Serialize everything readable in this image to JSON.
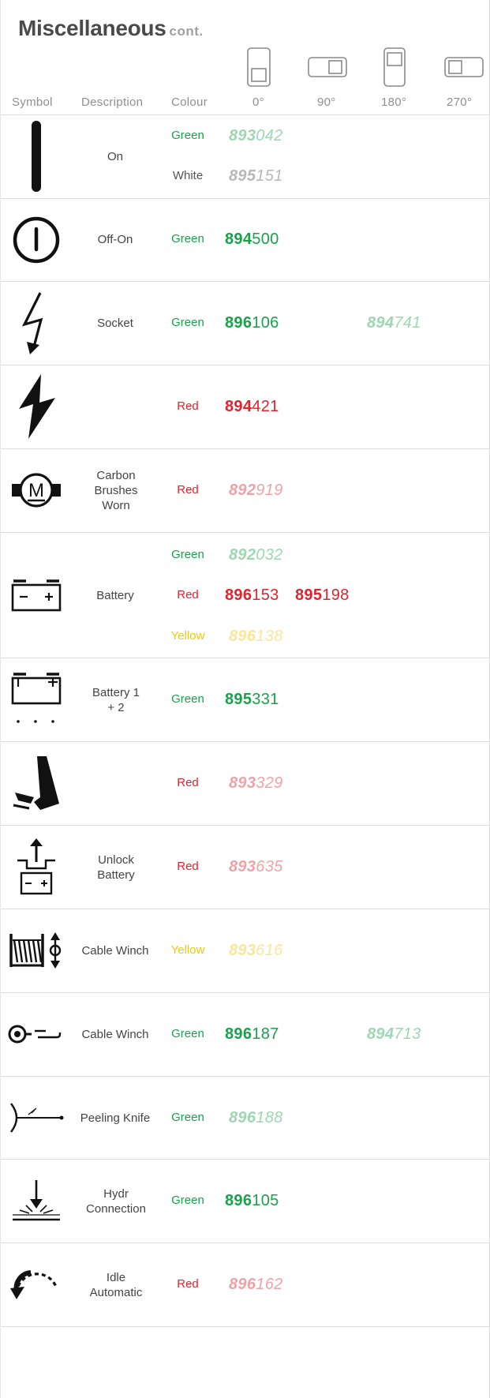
{
  "page": {
    "title": "Miscellaneous",
    "title_suffix": "cont."
  },
  "headers": {
    "symbol": "Symbol",
    "description": "Description",
    "colour": "Colour",
    "deg0": "0°",
    "deg90": "90°",
    "deg180": "180°",
    "deg270": "270°"
  },
  "rows": [
    {
      "symbol": "on-icon",
      "description": "On",
      "entries": [
        {
          "colour": "Green",
          "code_prefix": "893",
          "code_suffix": "042",
          "orientation": "0°",
          "dim": true
        },
        {
          "colour": "White",
          "code_prefix": "895",
          "code_suffix": "151",
          "orientation": "0°",
          "dim": true
        }
      ]
    },
    {
      "symbol": "off-on-icon",
      "description": "Off-On",
      "entries": [
        {
          "colour": "Green",
          "code_prefix": "894",
          "code_suffix": "500",
          "orientation": "0°",
          "dim": false
        }
      ]
    },
    {
      "symbol": "socket-icon",
      "description": "Socket",
      "entries": [
        {
          "colour": "Green",
          "code_prefix": "896",
          "code_suffix": "106",
          "orientation": "0°",
          "dim": false,
          "code2_prefix": "894",
          "code2_suffix": "741",
          "code2_orientation": "180°",
          "code2_dim": true
        }
      ]
    },
    {
      "symbol": "lightning-icon",
      "description": "",
      "entries": [
        {
          "colour": "Red",
          "code_prefix": "894",
          "code_suffix": "421",
          "orientation": "0°",
          "dim": false
        }
      ]
    },
    {
      "symbol": "motor-icon",
      "description": "Carbon Brushes Worn",
      "entries": [
        {
          "colour": "Red",
          "code_prefix": "892",
          "code_suffix": "919",
          "orientation": "0°",
          "dim": true
        }
      ]
    },
    {
      "symbol": "battery-icon",
      "description": "Battery",
      "entries": [
        {
          "colour": "Green",
          "code_prefix": "892",
          "code_suffix": "032",
          "orientation": "0°",
          "dim": true
        },
        {
          "colour": "Red",
          "code_prefix": "896",
          "code_suffix": "153",
          "orientation": "0°",
          "dim": false,
          "code2_prefix": "895",
          "code2_suffix": "198",
          "code2_orientation": "90°",
          "code2_dim": false
        },
        {
          "colour": "Yellow",
          "code_prefix": "896",
          "code_suffix": "138",
          "orientation": "0°",
          "dim": true
        }
      ]
    },
    {
      "symbol": "battery-1-2-icon",
      "description": "Battery 1 + 2",
      "entries": [
        {
          "colour": "Green",
          "code_prefix": "895",
          "code_suffix": "331",
          "orientation": "0°",
          "dim": false
        }
      ]
    },
    {
      "symbol": "pedal-icon",
      "description": "",
      "entries": [
        {
          "colour": "Red",
          "code_prefix": "893",
          "code_suffix": "329",
          "orientation": "0°",
          "dim": true
        }
      ]
    },
    {
      "symbol": "unlock-battery-icon",
      "description": "Unlock Battery",
      "entries": [
        {
          "colour": "Red",
          "code_prefix": "893",
          "code_suffix": "635",
          "orientation": "0°",
          "dim": true
        }
      ]
    },
    {
      "symbol": "cable-winch-drum-icon",
      "description": "Cable Winch",
      "entries": [
        {
          "colour": "Yellow",
          "code_prefix": "893",
          "code_suffix": "616",
          "orientation": "0°",
          "dim": true
        }
      ]
    },
    {
      "symbol": "cable-winch-hook-icon",
      "description": "Cable Winch",
      "entries": [
        {
          "colour": "Green",
          "code_prefix": "896",
          "code_suffix": "187",
          "orientation": "0°",
          "dim": false,
          "code2_prefix": "894",
          "code2_suffix": "713",
          "code2_orientation": "180°",
          "code2_dim": true
        }
      ]
    },
    {
      "symbol": "peeling-knife-icon",
      "description": "Peeling Knife",
      "entries": [
        {
          "colour": "Green",
          "code_prefix": "896",
          "code_suffix": "188",
          "orientation": "0°",
          "dim": true
        }
      ]
    },
    {
      "symbol": "hydr-connection-icon",
      "description": "Hydr Connection",
      "entries": [
        {
          "colour": "Green",
          "code_prefix": "896",
          "code_suffix": "105",
          "orientation": "0°",
          "dim": false
        }
      ]
    },
    {
      "symbol": "idle-automatic-icon",
      "description": "Idle Automatic",
      "entries": [
        {
          "colour": "Red",
          "code_prefix": "896",
          "code_suffix": "162",
          "orientation": "0°",
          "dim": true
        }
      ]
    }
  ]
}
